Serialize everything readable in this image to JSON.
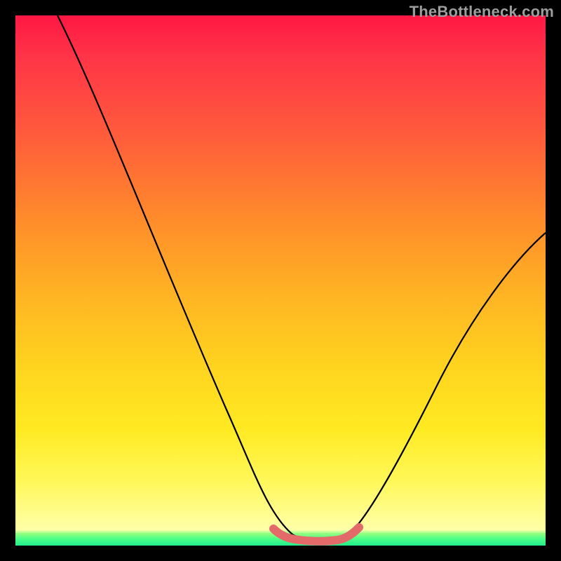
{
  "attribution": "TheBottleneck.com",
  "colors": {
    "background": "#000000",
    "curve_stroke": "#000000",
    "flat_segment_stroke": "#e46a6a"
  },
  "chart_data": {
    "type": "line",
    "title": "",
    "xlabel": "",
    "ylabel": "",
    "xlim": [
      0,
      100
    ],
    "ylim": [
      0,
      100
    ],
    "series": [
      {
        "name": "bottleneck-curve",
        "x": [
          8,
          12,
          18,
          24,
          30,
          36,
          42,
          47,
          50,
          53,
          56,
          59,
          62,
          64,
          70,
          76,
          82,
          88,
          94,
          100
        ],
        "values": [
          100,
          91,
          78,
          65,
          52,
          39,
          26,
          14,
          6,
          2,
          1,
          1,
          1,
          3,
          9,
          18,
          28,
          37,
          45,
          52
        ]
      },
      {
        "name": "optimal-flat-region",
        "x": [
          50,
          53,
          56,
          59,
          62
        ],
        "values": [
          2,
          1,
          1,
          1,
          2
        ]
      }
    ],
    "gradient_stops": [
      {
        "pos": 0,
        "color": "#ff1744"
      },
      {
        "pos": 22,
        "color": "#ff5a3c"
      },
      {
        "pos": 52,
        "color": "#ffb224"
      },
      {
        "pos": 78,
        "color": "#ffea22"
      },
      {
        "pos": 97,
        "color": "#ffffa8"
      },
      {
        "pos": 100,
        "color": "#18f08a"
      }
    ]
  }
}
